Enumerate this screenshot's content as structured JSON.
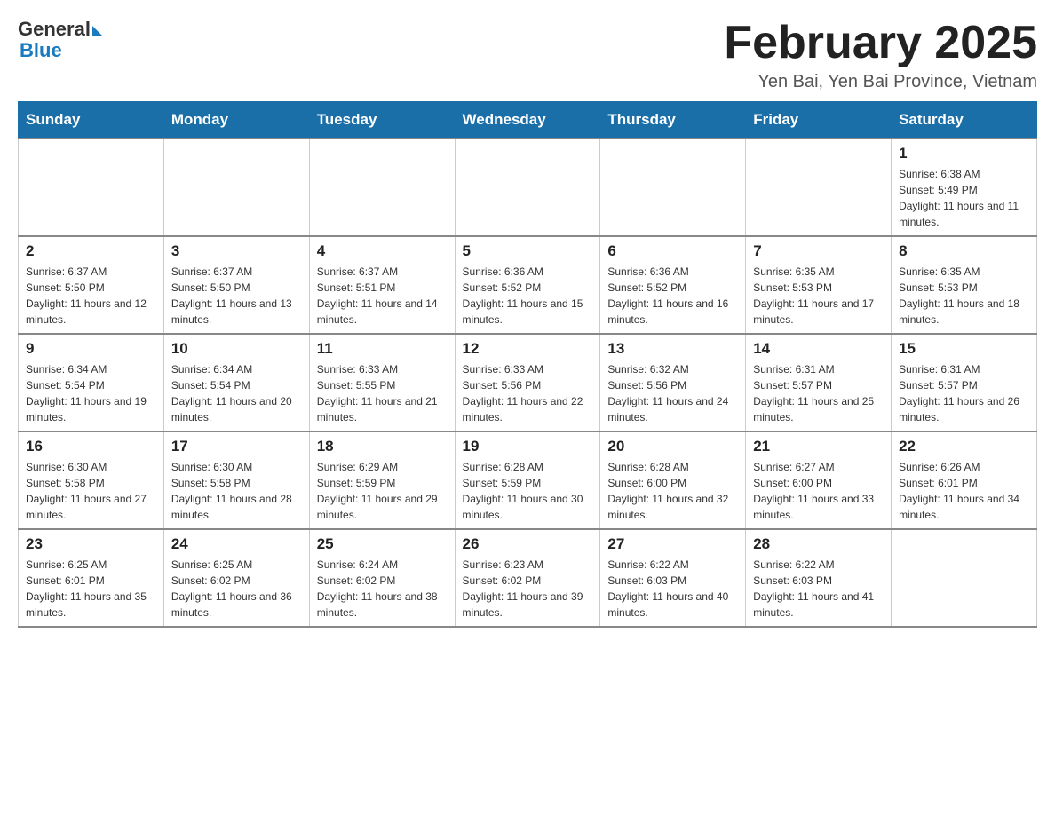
{
  "logo": {
    "general": "General",
    "blue": "Blue"
  },
  "header": {
    "title": "February 2025",
    "location": "Yen Bai, Yen Bai Province, Vietnam"
  },
  "weekdays": [
    "Sunday",
    "Monday",
    "Tuesday",
    "Wednesday",
    "Thursday",
    "Friday",
    "Saturday"
  ],
  "weeks": [
    [
      {
        "day": "",
        "info": ""
      },
      {
        "day": "",
        "info": ""
      },
      {
        "day": "",
        "info": ""
      },
      {
        "day": "",
        "info": ""
      },
      {
        "day": "",
        "info": ""
      },
      {
        "day": "",
        "info": ""
      },
      {
        "day": "1",
        "info": "Sunrise: 6:38 AM\nSunset: 5:49 PM\nDaylight: 11 hours and 11 minutes."
      }
    ],
    [
      {
        "day": "2",
        "info": "Sunrise: 6:37 AM\nSunset: 5:50 PM\nDaylight: 11 hours and 12 minutes."
      },
      {
        "day": "3",
        "info": "Sunrise: 6:37 AM\nSunset: 5:50 PM\nDaylight: 11 hours and 13 minutes."
      },
      {
        "day": "4",
        "info": "Sunrise: 6:37 AM\nSunset: 5:51 PM\nDaylight: 11 hours and 14 minutes."
      },
      {
        "day": "5",
        "info": "Sunrise: 6:36 AM\nSunset: 5:52 PM\nDaylight: 11 hours and 15 minutes."
      },
      {
        "day": "6",
        "info": "Sunrise: 6:36 AM\nSunset: 5:52 PM\nDaylight: 11 hours and 16 minutes."
      },
      {
        "day": "7",
        "info": "Sunrise: 6:35 AM\nSunset: 5:53 PM\nDaylight: 11 hours and 17 minutes."
      },
      {
        "day": "8",
        "info": "Sunrise: 6:35 AM\nSunset: 5:53 PM\nDaylight: 11 hours and 18 minutes."
      }
    ],
    [
      {
        "day": "9",
        "info": "Sunrise: 6:34 AM\nSunset: 5:54 PM\nDaylight: 11 hours and 19 minutes."
      },
      {
        "day": "10",
        "info": "Sunrise: 6:34 AM\nSunset: 5:54 PM\nDaylight: 11 hours and 20 minutes."
      },
      {
        "day": "11",
        "info": "Sunrise: 6:33 AM\nSunset: 5:55 PM\nDaylight: 11 hours and 21 minutes."
      },
      {
        "day": "12",
        "info": "Sunrise: 6:33 AM\nSunset: 5:56 PM\nDaylight: 11 hours and 22 minutes."
      },
      {
        "day": "13",
        "info": "Sunrise: 6:32 AM\nSunset: 5:56 PM\nDaylight: 11 hours and 24 minutes."
      },
      {
        "day": "14",
        "info": "Sunrise: 6:31 AM\nSunset: 5:57 PM\nDaylight: 11 hours and 25 minutes."
      },
      {
        "day": "15",
        "info": "Sunrise: 6:31 AM\nSunset: 5:57 PM\nDaylight: 11 hours and 26 minutes."
      }
    ],
    [
      {
        "day": "16",
        "info": "Sunrise: 6:30 AM\nSunset: 5:58 PM\nDaylight: 11 hours and 27 minutes."
      },
      {
        "day": "17",
        "info": "Sunrise: 6:30 AM\nSunset: 5:58 PM\nDaylight: 11 hours and 28 minutes."
      },
      {
        "day": "18",
        "info": "Sunrise: 6:29 AM\nSunset: 5:59 PM\nDaylight: 11 hours and 29 minutes."
      },
      {
        "day": "19",
        "info": "Sunrise: 6:28 AM\nSunset: 5:59 PM\nDaylight: 11 hours and 30 minutes."
      },
      {
        "day": "20",
        "info": "Sunrise: 6:28 AM\nSunset: 6:00 PM\nDaylight: 11 hours and 32 minutes."
      },
      {
        "day": "21",
        "info": "Sunrise: 6:27 AM\nSunset: 6:00 PM\nDaylight: 11 hours and 33 minutes."
      },
      {
        "day": "22",
        "info": "Sunrise: 6:26 AM\nSunset: 6:01 PM\nDaylight: 11 hours and 34 minutes."
      }
    ],
    [
      {
        "day": "23",
        "info": "Sunrise: 6:25 AM\nSunset: 6:01 PM\nDaylight: 11 hours and 35 minutes."
      },
      {
        "day": "24",
        "info": "Sunrise: 6:25 AM\nSunset: 6:02 PM\nDaylight: 11 hours and 36 minutes."
      },
      {
        "day": "25",
        "info": "Sunrise: 6:24 AM\nSunset: 6:02 PM\nDaylight: 11 hours and 38 minutes."
      },
      {
        "day": "26",
        "info": "Sunrise: 6:23 AM\nSunset: 6:02 PM\nDaylight: 11 hours and 39 minutes."
      },
      {
        "day": "27",
        "info": "Sunrise: 6:22 AM\nSunset: 6:03 PM\nDaylight: 11 hours and 40 minutes."
      },
      {
        "day": "28",
        "info": "Sunrise: 6:22 AM\nSunset: 6:03 PM\nDaylight: 11 hours and 41 minutes."
      },
      {
        "day": "",
        "info": ""
      }
    ]
  ]
}
